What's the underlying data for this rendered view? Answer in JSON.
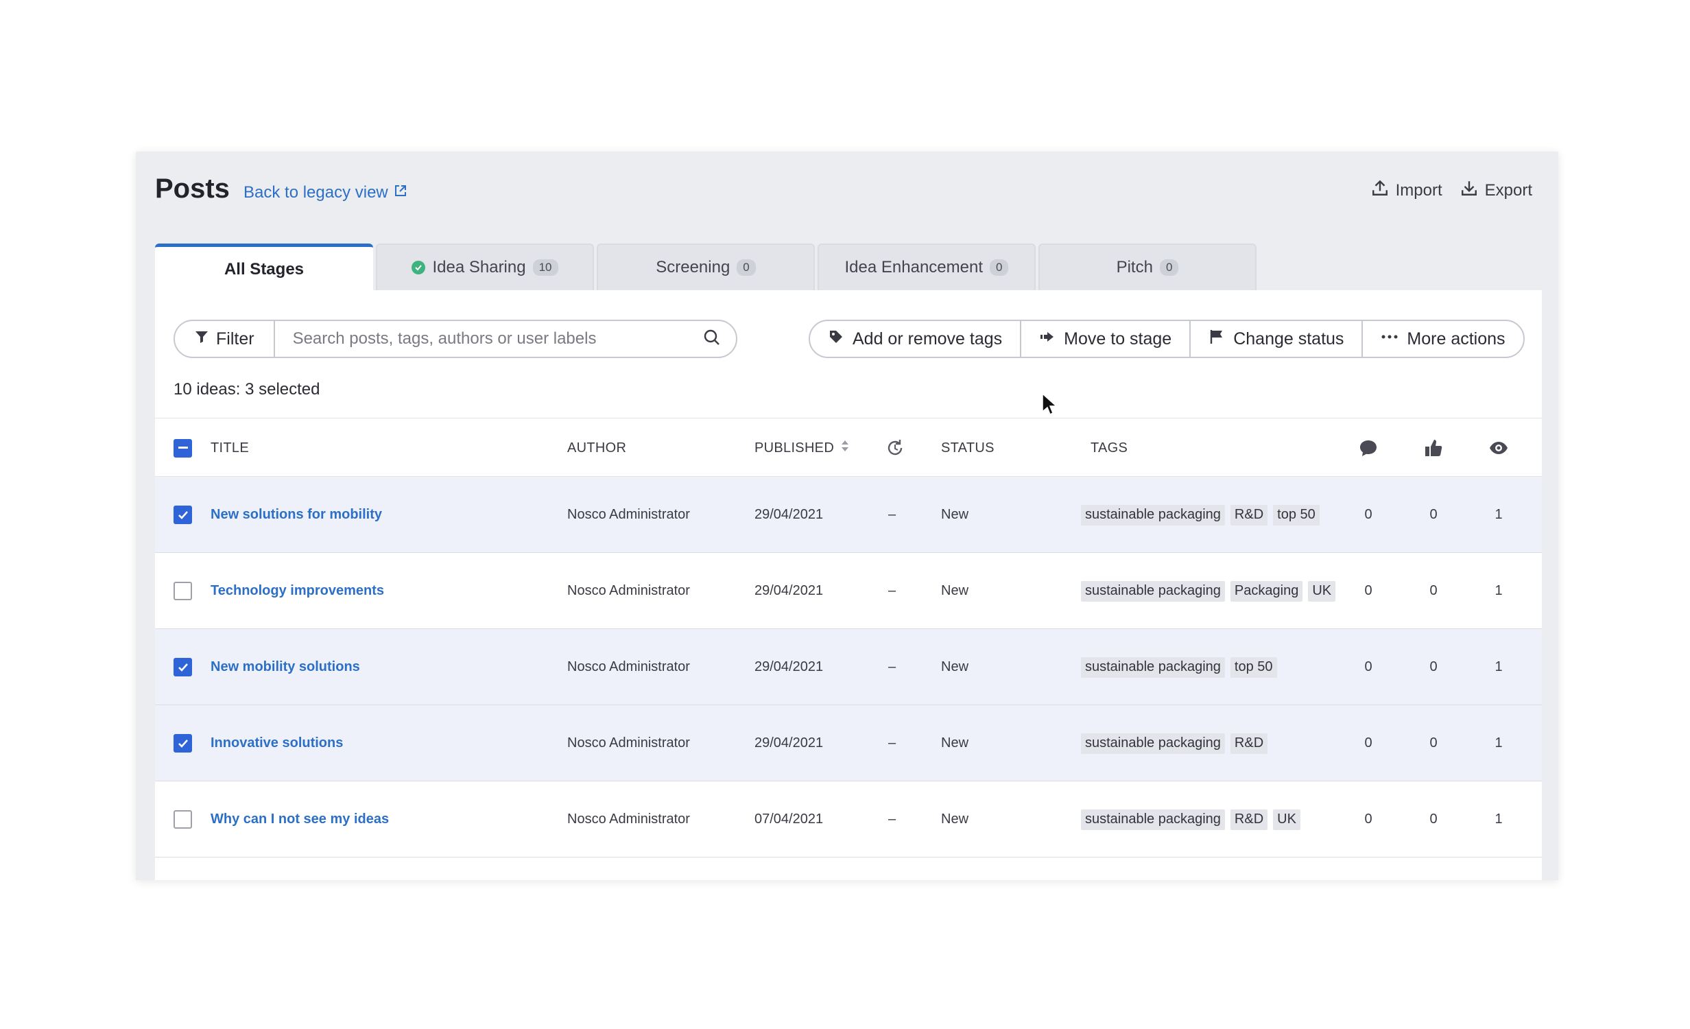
{
  "header": {
    "title": "Posts",
    "legacy_link": "Back to legacy view",
    "import_label": "Import",
    "export_label": "Export"
  },
  "tabs": [
    {
      "label": "All Stages",
      "count": null,
      "active": true
    },
    {
      "label": "Idea Sharing",
      "count": "10",
      "status_icon": "check-circle-icon"
    },
    {
      "label": "Screening",
      "count": "0"
    },
    {
      "label": "Idea Enhancement",
      "count": "0"
    },
    {
      "label": "Pitch",
      "count": "0"
    }
  ],
  "toolbar": {
    "filter_label": "Filter",
    "search_placeholder": "Search posts, tags, authors or user labels",
    "add_tags_label": "Add or remove tags",
    "move_stage_label": "Move to stage",
    "change_status_label": "Change status",
    "more_actions_label": "More actions"
  },
  "summary": "10 ideas: 3 selected",
  "columns": {
    "title": "TITLE",
    "author": "AUTHOR",
    "published": "PUBLISHED",
    "status": "STATUS",
    "tags": "TAGS"
  },
  "rows": [
    {
      "title": "New solutions for mobility",
      "author": "Nosco Administrator",
      "published": "29/04/2021",
      "updated": "–",
      "status": "New",
      "tags": [
        "sustainable packaging",
        "R&D",
        "top 50"
      ],
      "comments": "0",
      "likes": "0",
      "views": "1",
      "selected": true
    },
    {
      "title": "Technology improvements",
      "author": "Nosco Administrator",
      "published": "29/04/2021",
      "updated": "–",
      "status": "New",
      "tags": [
        "sustainable packaging",
        "Packaging",
        "UK"
      ],
      "comments": "0",
      "likes": "0",
      "views": "1",
      "selected": false
    },
    {
      "title": "New mobility solutions",
      "author": "Nosco Administrator",
      "published": "29/04/2021",
      "updated": "–",
      "status": "New",
      "tags": [
        "sustainable packaging",
        "top 50"
      ],
      "comments": "0",
      "likes": "0",
      "views": "1",
      "selected": true
    },
    {
      "title": "Innovative solutions",
      "author": "Nosco Administrator",
      "published": "29/04/2021",
      "updated": "–",
      "status": "New",
      "tags": [
        "sustainable packaging",
        "R&D"
      ],
      "comments": "0",
      "likes": "0",
      "views": "1",
      "selected": true
    },
    {
      "title": "Why can I not see my ideas",
      "author": "Nosco Administrator",
      "published": "07/04/2021",
      "updated": "–",
      "status": "New",
      "tags": [
        "sustainable packaging",
        "R&D",
        "UK"
      ],
      "comments": "0",
      "likes": "0",
      "views": "1",
      "selected": false
    }
  ],
  "colors": {
    "accent": "#2c6fc6",
    "checkbox": "#2f64d8",
    "success": "#3fb37f"
  }
}
